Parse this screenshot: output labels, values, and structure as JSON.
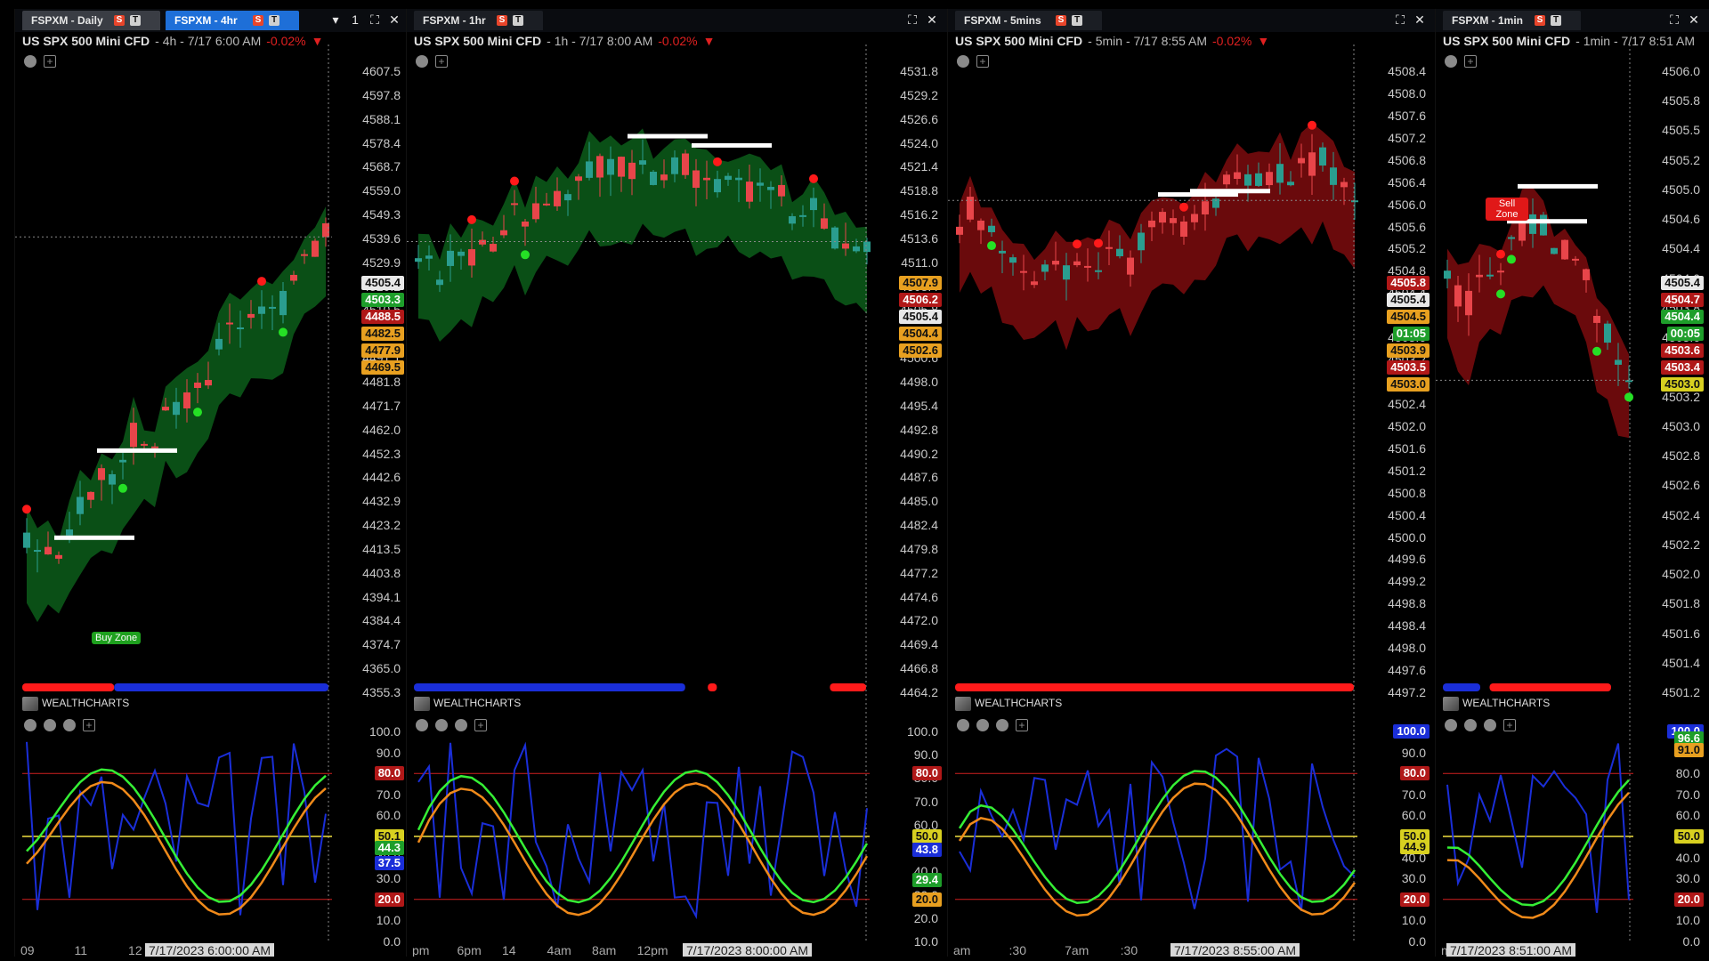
{
  "colors": {
    "accent": "#1e6fd8",
    "bear": "#e8454a",
    "bull": "#2a9d8f",
    "cloud_green": "#0e6a1e",
    "cloud_red": "#8e0e10",
    "oscillator_blue": "#1a2ed8",
    "oscillator_green": "#35ef35",
    "oscillator_orange": "#f08a1a",
    "level_red": "#d02020",
    "level_yellow": "#f0e040"
  },
  "panels": [
    {
      "tabs": [
        {
          "label": "FSPXM - Daily",
          "state": "inactive"
        },
        {
          "label": "FSPXM - 4hr",
          "state": "active"
        }
      ],
      "badge_s": "S",
      "badge_t": "T",
      "window_controls": [
        "▾",
        "1",
        "⛶",
        "✕"
      ],
      "symbol": "US SPX 500 Mini CFD",
      "period": "- 4h - 7/17 6:00 AM",
      "change": "-0.02%",
      "change_arrow": "▼",
      "price_ticks": [
        "4607.5",
        "4597.8",
        "4588.1",
        "4578.4",
        "4568.7",
        "4559.0",
        "4549.3",
        "4539.6",
        "4529.9",
        "4520.2",
        "4510.5",
        "4501.0",
        "4491.1",
        "4481.8",
        "4471.7",
        "4462.0",
        "4452.3",
        "4442.6",
        "4432.9",
        "4423.2",
        "4413.5",
        "4403.8",
        "4394.1",
        "4384.4",
        "4374.7",
        "4365.0",
        "4355.3"
      ],
      "price_tags": [
        {
          "value": "4505.4",
          "kind": "white"
        },
        {
          "value": "4503.3",
          "kind": "green"
        },
        {
          "value": "4488.5",
          "kind": "red"
        },
        {
          "value": "4482.5",
          "kind": "orange"
        },
        {
          "value": "4477.9",
          "kind": "orange"
        },
        {
          "value": "4469.5",
          "kind": "orange"
        }
      ],
      "buy_zone_label": "Buy Zone",
      "brand": "WEALTHCHARTS",
      "osc_ticks": [
        "100.0",
        "90.0",
        "80.0",
        "70.0",
        "60.0",
        "50.0",
        "40.0",
        "30.0",
        "20.0",
        "10.0",
        "0.0"
      ],
      "osc_tags": [
        {
          "value": "80.0",
          "kind": "red"
        },
        {
          "value": "50.1",
          "kind": "yellow"
        },
        {
          "value": "44.3",
          "kind": "green"
        },
        {
          "value": "37.5",
          "kind": "blue"
        },
        {
          "value": "20.0",
          "kind": "red"
        }
      ],
      "x_labels": [
        "09",
        "11",
        "12",
        "13"
      ],
      "x_stamp": "7/17/2023 6:00:00 AM"
    },
    {
      "tabs": [
        {
          "label": "FSPXM - 1hr",
          "state": "plain"
        }
      ],
      "badge_s": "S",
      "badge_t": "T",
      "window_controls": [
        "⛶",
        "✕"
      ],
      "symbol": "US SPX 500 Mini CFD",
      "period": "- 1h - 7/17 8:00 AM",
      "change": "-0.02%",
      "change_arrow": "▼",
      "price_ticks": [
        "4531.8",
        "4529.2",
        "4526.6",
        "4524.0",
        "4521.4",
        "4518.8",
        "4516.2",
        "4513.6",
        "4511.0",
        "4508.4",
        "4505.8",
        "4503.2",
        "4500.6",
        "4498.0",
        "4495.4",
        "4492.8",
        "4490.2",
        "4487.6",
        "4485.0",
        "4482.4",
        "4479.8",
        "4477.2",
        "4474.6",
        "4472.0",
        "4469.4",
        "4466.8",
        "4464.2"
      ],
      "price_tags": [
        {
          "value": "4507.9",
          "kind": "orange"
        },
        {
          "value": "4506.2",
          "kind": "red"
        },
        {
          "value": "4505.4",
          "kind": "white"
        },
        {
          "value": "4504.4",
          "kind": "orange"
        },
        {
          "value": "4502.6",
          "kind": "orange"
        }
      ],
      "brand": "WEALTHCHARTS",
      "osc_ticks": [
        "100.0",
        "90.0",
        "80.0",
        "70.0",
        "60.0",
        "50.0",
        "40.0",
        "30.0",
        "20.0",
        "10.0"
      ],
      "osc_tags": [
        {
          "value": "80.0",
          "kind": "red"
        },
        {
          "value": "50.0",
          "kind": "yellow"
        },
        {
          "value": "43.8",
          "kind": "blue"
        },
        {
          "value": "29.4",
          "kind": "green"
        },
        {
          "value": "20.0",
          "kind": "orange"
        }
      ],
      "x_labels": [
        "pm",
        "6pm",
        "14",
        "4am",
        "8am",
        "12pm",
        "16"
      ],
      "x_stamp": "7/17/2023 8:00:00 AM"
    },
    {
      "tabs": [
        {
          "label": "FSPXM - 5mins",
          "state": "plain"
        }
      ],
      "badge_s": "S",
      "badge_t": "T",
      "window_controls": [
        "⛶",
        "✕"
      ],
      "symbol": "US SPX 500 Mini CFD",
      "period": "- 5min - 7/17 8:55 AM",
      "change": "-0.02%",
      "change_arrow": "▼",
      "price_ticks": [
        "4508.4",
        "4508.0",
        "4507.6",
        "4507.2",
        "4506.8",
        "4506.4",
        "4506.0",
        "4505.6",
        "4505.2",
        "4504.8",
        "4504.4",
        "4504.0",
        "4503.6",
        "4503.2",
        "4502.8",
        "4502.4",
        "4502.0",
        "4501.6",
        "4501.2",
        "4500.8",
        "4500.4",
        "4500.0",
        "4499.6",
        "4499.2",
        "4498.8",
        "4498.4",
        "4498.0",
        "4497.6",
        "4497.2"
      ],
      "price_tags": [
        {
          "value": "4505.8",
          "kind": "red"
        },
        {
          "value": "4505.4",
          "kind": "white"
        },
        {
          "value": "4504.5",
          "kind": "orange"
        },
        {
          "value": "01:05",
          "kind": "green"
        },
        {
          "value": "4503.9",
          "kind": "orange"
        },
        {
          "value": "4503.5",
          "kind": "red"
        },
        {
          "value": "4503.0",
          "kind": "orange"
        }
      ],
      "brand": "WEALTHCHARTS",
      "osc_ticks": [
        "100.0",
        "90.0",
        "80.0",
        "70.0",
        "60.0",
        "50.0",
        "40.0",
        "30.0",
        "20.0",
        "10.0",
        "0.0"
      ],
      "osc_tags": [
        {
          "value": "100.0",
          "kind": "blue"
        },
        {
          "value": "80.0",
          "kind": "red"
        },
        {
          "value": "50.0",
          "kind": "yellow"
        },
        {
          "value": "44.9",
          "kind": "yellow"
        },
        {
          "value": "20.0",
          "kind": "red"
        }
      ],
      "x_labels": [
        "am",
        ":30",
        "7am",
        ":30",
        "8am"
      ],
      "x_stamp": "7/17/2023 8:55:00 AM"
    },
    {
      "tabs": [
        {
          "label": "FSPXM - 1min",
          "state": "plain"
        }
      ],
      "badge_s": "S",
      "badge_t": "T",
      "window_controls": [
        "⛶",
        "✕"
      ],
      "symbol": "US SPX 500 Mini CFD",
      "period": "- 1min - 7/17 8:51 AM",
      "change": "",
      "change_arrow": "",
      "price_ticks": [
        "4506.0",
        "4505.8",
        "4505.5",
        "4505.2",
        "4505.0",
        "4504.6",
        "4504.4",
        "4504.0",
        "4503.8",
        "4503.6",
        "4503.4",
        "4503.2",
        "4503.0",
        "4502.8",
        "4502.6",
        "4502.4",
        "4502.2",
        "4502.0",
        "4501.8",
        "4501.6",
        "4501.4",
        "4501.2"
      ],
      "price_tags": [
        {
          "value": "4505.4",
          "kind": "white"
        },
        {
          "value": "4504.7",
          "kind": "red"
        },
        {
          "value": "4504.4",
          "kind": "green"
        },
        {
          "value": "00:05",
          "kind": "green"
        },
        {
          "value": "4503.6",
          "kind": "red"
        },
        {
          "value": "4503.4",
          "kind": "red"
        },
        {
          "value": "4503.0",
          "kind": "yellow"
        }
      ],
      "sell_zone_label": "Sell Zone",
      "brand": "WEALTHCHARTS",
      "osc_ticks": [
        "100.0",
        "90.0",
        "80.0",
        "70.0",
        "60.0",
        "50.0",
        "40.0",
        "30.0",
        "20.0",
        "10.0",
        "0.0"
      ],
      "osc_tags": [
        {
          "value": "100.0",
          "kind": "blue"
        },
        {
          "value": "96.6",
          "kind": "green"
        },
        {
          "value": "91.0",
          "kind": "orange"
        },
        {
          "value": "50.0",
          "kind": "yellow"
        },
        {
          "value": "20.0",
          "kind": "red"
        }
      ],
      "x_labels": [
        "m"
      ],
      "x_stamp": "7/17/2023 8:51:00 AM"
    }
  ]
}
